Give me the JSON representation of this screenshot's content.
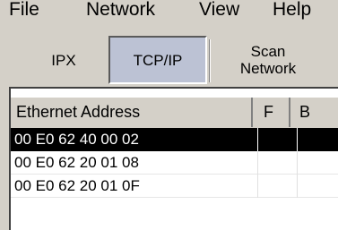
{
  "menu": {
    "items": [
      "File",
      "Network",
      "View",
      "Help"
    ]
  },
  "toolbar": {
    "buttons": [
      {
        "label": "IPX",
        "pressed": false
      },
      {
        "label": "TCP/IP",
        "pressed": true
      },
      {
        "label": "Scan\nNetwork",
        "pressed": false
      }
    ]
  },
  "table": {
    "columns": [
      "Ethernet Address",
      "F",
      "B"
    ],
    "rows": [
      {
        "address": "00 E0 62 40 00 02",
        "selected": true
      },
      {
        "address": "00 E0 62 20 01 08",
        "selected": false
      },
      {
        "address": "00 E0 62 20 01 0F",
        "selected": false
      }
    ]
  },
  "colors": {
    "selection": "#000000",
    "pressed_button": "#bcc2d4",
    "window": "#d4d0c8"
  }
}
